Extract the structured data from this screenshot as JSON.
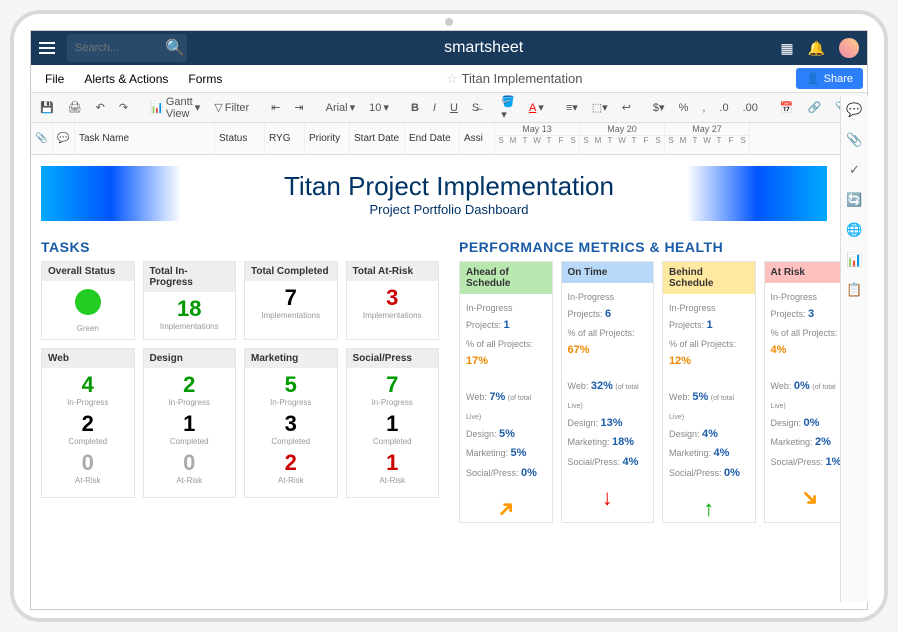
{
  "brand": "smartsheet",
  "search_ph": "Search...",
  "menu": {
    "file": "File",
    "alerts": "Alerts & Actions",
    "forms": "Forms",
    "title": "Titan Implementation",
    "share": "Share"
  },
  "toolbar": {
    "gantt": "Gantt View",
    "filter": "Filter",
    "font": "Arial",
    "size": "10"
  },
  "cols": {
    "taskname": "Task Name",
    "status": "Status",
    "ryg": "RYG",
    "priority": "Priority",
    "start": "Start Date",
    "end": "End Date",
    "assi": "Assi"
  },
  "weeks": [
    "May 13",
    "May 20",
    "May 27"
  ],
  "days": [
    "S",
    "M",
    "T",
    "W",
    "T",
    "F",
    "S"
  ],
  "banner": {
    "title": "Titan Project Implementation",
    "sub": "Project Portfolio Dashboard"
  },
  "tasks_title": "TASKS",
  "perf_title": "PERFORMANCE METRICS & HEALTH",
  "status_cards": [
    {
      "h": "Overall Status",
      "label": "Green",
      "type": "circle"
    },
    {
      "h": "Total In-Progress",
      "v": "18",
      "label": "Implementations",
      "cls": "green"
    },
    {
      "h": "Total Completed",
      "v": "7",
      "label": "Implementations",
      "cls": "black"
    },
    {
      "h": "Total At-Risk",
      "v": "3",
      "label": "Implementations",
      "cls": "red"
    }
  ],
  "dept_cards": [
    {
      "h": "Web",
      "ip": "4",
      "comp": "2",
      "ar": "0",
      "arcls": "gray"
    },
    {
      "h": "Design",
      "ip": "2",
      "comp": "1",
      "ar": "0",
      "arcls": "gray"
    },
    {
      "h": "Marketing",
      "ip": "5",
      "comp": "3",
      "ar": "2",
      "arcls": "red"
    },
    {
      "h": "Social/Press",
      "ip": "7",
      "comp": "1",
      "ar": "1",
      "arcls": "red"
    }
  ],
  "dept_labels": {
    "ip": "In-Progress",
    "comp": "Completed",
    "ar": "At-Risk"
  },
  "perf": [
    {
      "h": "Ahead of Schedule",
      "cls": "ph-green",
      "ipp": "1",
      "pct": "17%",
      "web": "7%",
      "design": "5%",
      "mkt": "5%",
      "sp": "0%",
      "arrow": "arr-up-o"
    },
    {
      "h": "On Time",
      "cls": "ph-blue",
      "ipp": "6",
      "pct": "67%",
      "web": "32%",
      "design": "13%",
      "mkt": "18%",
      "sp": "4%",
      "arrow": "arr-dn-r"
    },
    {
      "h": "Behind Schedule",
      "cls": "ph-yellow",
      "ipp": "1",
      "pct": "12%",
      "web": "5%",
      "design": "4%",
      "mkt": "4%",
      "sp": "0%",
      "arrow": "arr-up-g"
    },
    {
      "h": "At Risk",
      "cls": "ph-red",
      "ipp": "3",
      "pct": "4%",
      "web": "0%",
      "design": "0%",
      "mkt": "2%",
      "sp": "1%",
      "arrow": "arr-dn-o"
    }
  ],
  "perf_labels": {
    "ipp": "In-Progress Projects:",
    "pct": "% of all Projects:",
    "web": "Web:",
    "design": "Design:",
    "mkt": "Marketing:",
    "sp": "Social/Press:",
    "oftotal": "(of total Live)"
  }
}
